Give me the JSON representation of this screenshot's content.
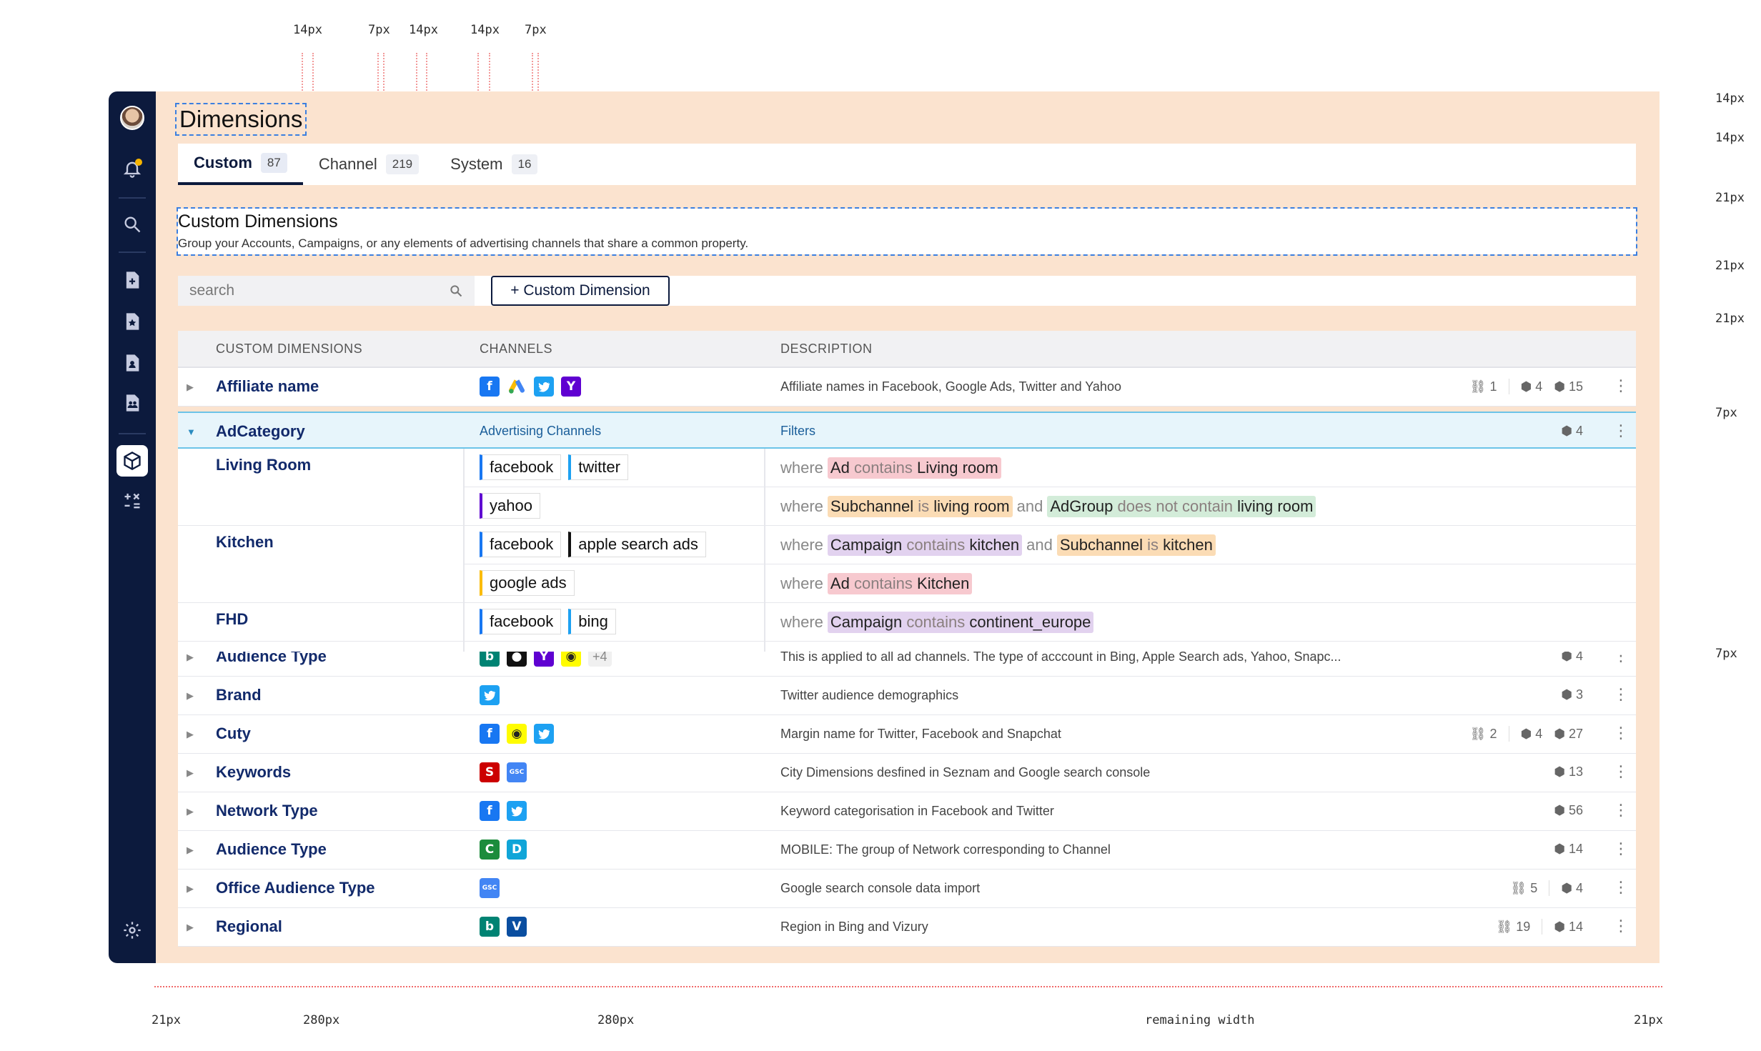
{
  "annotations": {
    "top": [
      "14px",
      "7px",
      "14px",
      "14px",
      "7px"
    ],
    "right": [
      "14px",
      "14px",
      "21px",
      "21px",
      "21px",
      "7px",
      "7px"
    ],
    "bottom": [
      "21px",
      "280px",
      "280px",
      "remaining width",
      "21px"
    ]
  },
  "page": {
    "title": "Dimensions"
  },
  "tabs": [
    {
      "label": "Custom",
      "count": "87"
    },
    {
      "label": "Channel",
      "count": "219"
    },
    {
      "label": "System",
      "count": "16"
    }
  ],
  "section": {
    "title": "Custom Dimensions",
    "description": "Group your Accounts, Campaigns, or any elements of advertising channels that share a common property."
  },
  "search": {
    "placeholder": "search"
  },
  "add_button": {
    "label": "+ Custom Dimension"
  },
  "columns": {
    "name": "CUSTOM DIMENSIONS",
    "channels": "CHANNELS",
    "description": "DESCRIPTION"
  },
  "rows": [
    {
      "name": "Affiliate name",
      "channels": [
        "facebook-icon",
        "google-ads-icon",
        "twitter-icon",
        "yahoo-icon"
      ],
      "description": "Affiliate names in Facebook, Google Ads, Twitter and Yahoo",
      "links": "1",
      "dims": "4",
      "items": "15"
    },
    {
      "name": "Audience Type",
      "channels": [
        "bing-icon",
        "apple-icon",
        "yahoo-icon",
        "snapchat-icon"
      ],
      "more": "+4",
      "description": "This is applied to all ad channels. The type of acccount in Bing, Apple Search ads, Yahoo, Snapc...",
      "dims": "4"
    },
    {
      "name": "Brand",
      "channels": [
        "twitter-icon"
      ],
      "description": "Twitter audience demographics",
      "dims": "3"
    },
    {
      "name": "Cuty",
      "channels": [
        "facebook-icon",
        "snapchat-icon",
        "twitter-icon"
      ],
      "description": "Margin name for Twitter, Facebook and Snapchat",
      "links": "2",
      "dims": "4",
      "items": "27"
    },
    {
      "name": "Keywords",
      "channels": [
        "seznam-icon",
        "gsc-icon"
      ],
      "description": "City Dimensions desfined in Seznam and Google search console",
      "dims": "13"
    },
    {
      "name": "Network Type",
      "channels": [
        "facebook-icon",
        "twitter-icon"
      ],
      "description": "Keyword categorisation in Facebook and Twitter",
      "dims": "56"
    },
    {
      "name": "Audience Type",
      "channels": [
        "criteo-icon",
        "sklik-icon"
      ],
      "description": "MOBILE: The group of Network corresponding to Channel",
      "dims": "14"
    },
    {
      "name": "Office Audience Type",
      "channels": [
        "gsc-icon"
      ],
      "description": "Google search console data import",
      "links": "5",
      "dims": "4"
    },
    {
      "name": "Regional",
      "channels": [
        "bing-icon",
        "vizury-icon"
      ],
      "description": "Region in Bing and Vizury",
      "links": "19",
      "items": "14"
    }
  ],
  "expanded": {
    "name": "AdCategory",
    "channels_header": "Advertising Channels",
    "filters_header": "Filters",
    "dims": "4",
    "where": "where",
    "and": "and",
    "groups": [
      {
        "name": "Living Room",
        "rules": [
          {
            "tags": [
              "facebook",
              "twitter"
            ],
            "conds": [
              {
                "field": "Ad",
                "op": "contains",
                "value": "Living room",
                "color": "pink"
              }
            ]
          },
          {
            "tags": [
              "yahoo"
            ],
            "conds": [
              {
                "field": "Subchannel",
                "op": "is",
                "value": "living room",
                "color": "orange"
              },
              {
                "field": "AdGroup",
                "op": "does not contain",
                "value": "living room",
                "color": "green"
              }
            ]
          }
        ]
      },
      {
        "name": "Kitchen",
        "rules": [
          {
            "tags": [
              "facebook",
              "apple search ads"
            ],
            "conds": [
              {
                "field": "Campaign",
                "op": "contains",
                "value": "kitchen",
                "color": "purple"
              },
              {
                "field": "Subchannel",
                "op": "is",
                "value": "kitchen",
                "color": "orange"
              }
            ]
          },
          {
            "tags": [
              "google ads"
            ],
            "conds": [
              {
                "field": "Ad",
                "op": "contains",
                "value": "Kitchen",
                "color": "pink"
              }
            ]
          }
        ]
      },
      {
        "name": "FHD",
        "rules": [
          {
            "tags": [
              "facebook",
              "bing"
            ],
            "conds": [
              {
                "field": "Campaign",
                "op": "contains",
                "value": "continent_europe",
                "color": "purple"
              }
            ]
          }
        ]
      }
    ]
  },
  "colors": {
    "sidebar": "#0c1a3d",
    "spacing_overlay": "#fbe3cf",
    "accent": "#122a6b",
    "expanded_row": "#e7f5fb",
    "chip_pink": "#f7c9cf",
    "chip_orange": "#fbdcb5",
    "chip_green": "#d3ecd9",
    "chip_purple": "#e2d2ef"
  }
}
